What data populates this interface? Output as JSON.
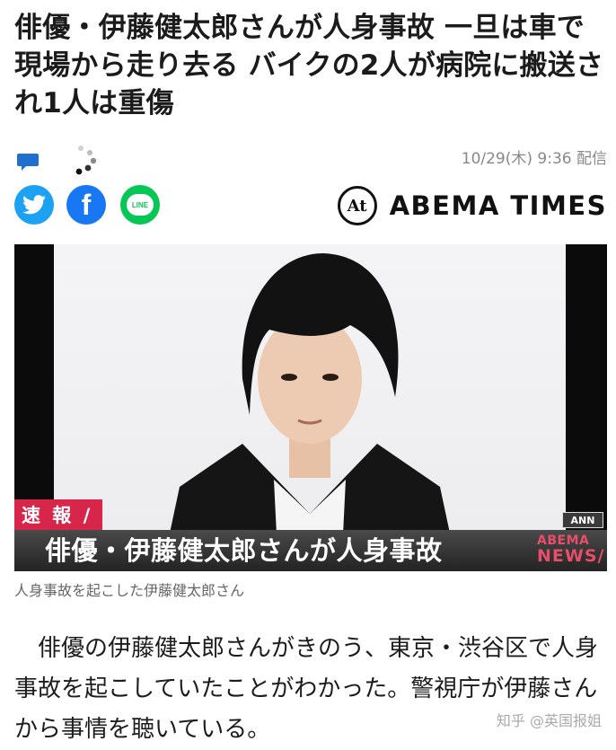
{
  "article": {
    "headline": "俳優・伊藤健太郎さんが人身事故 一旦は車で現場から走り去る バイクの2人が病院に搬送され1人は重傷",
    "timestamp": "10/29(木) 9:36 配信",
    "image_caption": "人身事故を起こした伊藤健太郎さん",
    "body": "俳優の伊藤健太郎さんがきのう、東京・渋谷区で人身事故を起こしていたことがわかった。警視庁が伊藤さんから事情を聴いている。"
  },
  "meta": {
    "comment_icon": "comment-icon",
    "loading_icon": "loading-spinner-icon"
  },
  "share": {
    "twitter_icon": "twitter-icon",
    "facebook_icon": "facebook-icon",
    "line_icon": "line-icon",
    "line_label": "LINE",
    "facebook_label": "f"
  },
  "brand": {
    "logo_text": "At",
    "name": "ABEMA TIMES"
  },
  "hero": {
    "breaking_label": "速 報 /",
    "ann_label": "ANN",
    "caption_bar_text": "俳優・伊藤健太郎さんが人身事故",
    "news_badge_line1": "ABEMA",
    "news_badge_line2": "NEWS/"
  },
  "watermark": "知乎 @英国报姐",
  "colors": {
    "twitter": "#1da1f2",
    "facebook": "#1877f2",
    "line": "#06c755",
    "breaking": "#d8264a",
    "news_badge": "#e84d6a"
  }
}
